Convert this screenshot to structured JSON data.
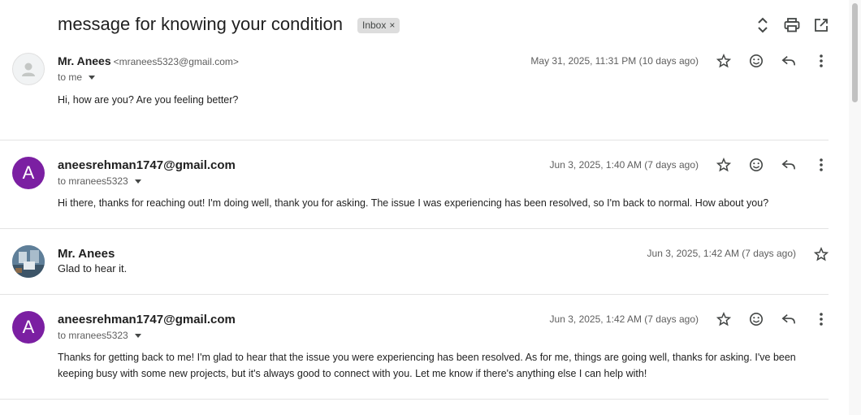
{
  "thread": {
    "subject": "message for knowing your condition",
    "label": "Inbox",
    "label_remove": "×"
  },
  "toolbar_icons": [
    "expand-collapse-icon",
    "print-icon",
    "open-new-window-icon"
  ],
  "messages": [
    {
      "sender": "Mr. Anees",
      "email": "<mranees5323@gmail.com>",
      "to": "to me",
      "date": "May 31, 2025, 11:31 PM (10 days ago)",
      "body": "Hi, how are you? Are you feeling better?",
      "avatar": "default-person"
    },
    {
      "sender": "aneesrehman1747@gmail.com",
      "avatar_letter": "A",
      "to": "to mranees5323",
      "date": "Jun 3, 2025, 1:40 AM (7 days ago)",
      "body": "Hi there, thanks for reaching out! I'm doing well, thank you for asking. The issue I was experiencing has been resolved, so I'm back to normal. How about you?"
    },
    {
      "sender": "Mr. Anees",
      "date": "Jun 3, 2025, 1:42 AM (7 days ago)",
      "body": "Glad to hear it.",
      "avatar": "photo"
    },
    {
      "sender": "aneesrehman1747@gmail.com",
      "avatar_letter": "A",
      "to": "to mranees5323",
      "date": "Jun 3, 2025, 1:42 AM (7 days ago)",
      "body": "Thanks for getting back to me! I'm glad to hear that the issue you were experiencing has been resolved. As for me, things are going well, thanks for asking. I've been keeping busy with some new projects, but it's always good to connect with you. Let me know if there's anything else I can help with!"
    }
  ],
  "colors": {
    "avatar_purple": "#7b1fa2",
    "text_primary": "#1f1f1f",
    "text_secondary": "#5e5e5e",
    "divider": "#e3e3e3"
  }
}
